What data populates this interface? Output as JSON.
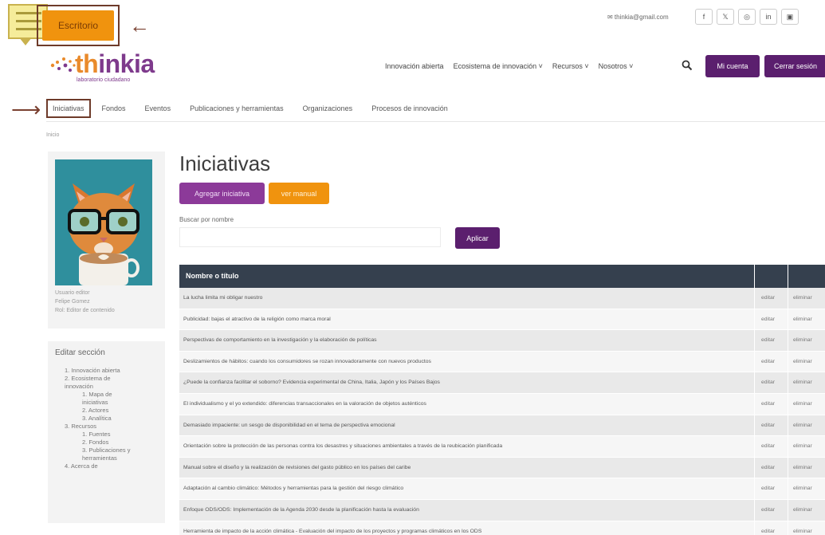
{
  "top": {
    "escritorio_label": "Escritorio",
    "arrow_glyph": "←",
    "arrow_right_glyph": "⟶",
    "contact_email": "✉ thinkia@gmail.com",
    "socials": [
      "f",
      "𝕏",
      "◎",
      "in",
      "▣"
    ]
  },
  "logo": {
    "name_first": "th",
    "name_rest": "inkia",
    "tagline": "laboratorio ciudadano"
  },
  "mainnav": {
    "items": [
      "Innovación abierta",
      "Ecosistema de innovación ˅",
      "Recursos ˅",
      "Nosotros ˅"
    ],
    "mi_cuenta": "Mi cuenta",
    "cerrar_sesion": "Cerrar sesión"
  },
  "subnav": {
    "items": [
      "Iniciativas",
      "Fondos",
      "Eventos",
      "Publicaciones y herramientas",
      "Organizaciones",
      "Procesos de innovación"
    ]
  },
  "breadcrumb": "Inicio",
  "sidebar": {
    "author_lines": [
      "Usuario editor",
      "Felipe Gomez",
      "Rol: Editor de contenido"
    ],
    "edit_title": "Editar sección",
    "edit_items": [
      {
        "text": "1. Innovación abierta",
        "level": 1
      },
      {
        "text": "2. Ecosistema de",
        "level": 1
      },
      {
        "text": "innovación",
        "level": 1
      },
      {
        "text": "1. Mapa de",
        "level": 2
      },
      {
        "text": "iniciativas",
        "level": 2
      },
      {
        "text": "2. Actores",
        "level": 2
      },
      {
        "text": "3. Analítica",
        "level": 2
      },
      {
        "text": "3. Recursos",
        "level": 1
      },
      {
        "text": "1. Fuentes",
        "level": 2
      },
      {
        "text": "2. Fondos",
        "level": 2
      },
      {
        "text": "3. Publicaciones y",
        "level": 2
      },
      {
        "text": "herramientas",
        "level": 2
      },
      {
        "text": "4. Acerca de",
        "level": 1
      }
    ]
  },
  "content": {
    "title": "Iniciativas",
    "add_button": "Agregar iniciativa",
    "manual_button": "ver manual",
    "search_label": "Buscar por nombre",
    "search_value": "",
    "apply_button": "Aplicar",
    "table": {
      "headers": [
        "Nombre o título",
        "",
        ""
      ],
      "action_edit": "editar",
      "action_delete": "eliminar",
      "rows": [
        "La lucha limita mi obligar nuestro",
        "Publicidad: bajas el atractivo de la religión como marca moral",
        "Perspectivas de comportamiento en la investigación y la elaboración de políticas",
        "Deslizamientos de hábitos: cuando los consumidores se rozan innovadoramente con nuevos productos",
        "¿Puede la confianza facilitar el soborno? Evidencia experimental de China, Italia, Japón y los Países Bajos",
        "El individualismo y el yo extendido: diferencias transaccionales en la valoración de objetos auténticos",
        "Demasiado impaciente: un sesgo de disponibilidad en el tema de perspectiva emocional",
        "Orientación sobre la protección de las personas contra los desastres y situaciones ambientales a través de la reubicación planificada",
        "Manual sobre el diseño y la realización de revisiones del gasto público en los países del caribe",
        "Adaptación al cambio climático: Métodos y herramientas para la gestión del riesgo climático",
        "Enfoque ODS/ODS: Implementación de la Agenda 2030 desde la planificación hasta la evaluación",
        "Herramienta de impacto de la acción climática - Evaluación del impacto de los proyectos y programas climáticos en los ODS"
      ]
    }
  },
  "colors": {
    "purple_dark": "#5b1f6e",
    "purple": "#8c3a99",
    "orange": "#f0930e",
    "table_header": "#35404e"
  }
}
